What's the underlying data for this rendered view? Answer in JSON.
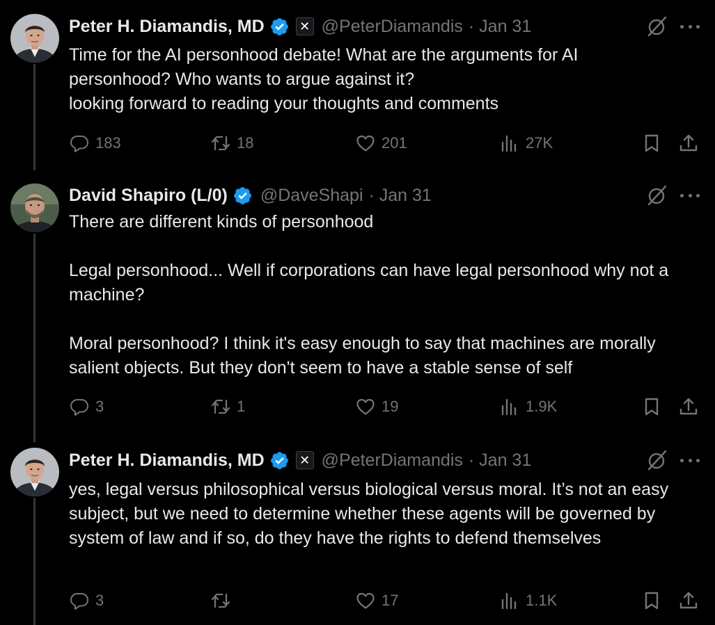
{
  "colors": {
    "background": "#000000",
    "text_primary": "#e7e9ea",
    "text_secondary": "#71767b",
    "verified_badge": "#1d9bf0",
    "thread_line": "#333639"
  },
  "icons": {
    "verified": "verified-badge-icon",
    "affiliate": "x-affiliate-badge-icon",
    "grok": "grok-icon",
    "more": "more-icon",
    "reply": "reply-icon",
    "retweet": "retweet-icon",
    "like": "heart-icon",
    "views": "views-icon",
    "bookmark": "bookmark-icon",
    "share": "share-icon"
  },
  "tweets": [
    {
      "author": "Peter H. Diamandis, MD",
      "affiliate_badge": "✕",
      "handle": "@PeterDiamandis",
      "date": "· Jan 31",
      "paragraphs": [
        "Time for the AI personhood debate!  What are the arguments for AI personhood? Who wants to argue against it?",
        "looking forward to reading your thoughts and comments"
      ],
      "replies": "183",
      "retweets": "18",
      "likes": "201",
      "views": "27K"
    },
    {
      "author": "David Shapiro (L/0)",
      "handle": "@DaveShapi",
      "date": "· Jan 31",
      "paragraphs": [
        "There are different kinds of personhood",
        "Legal personhood... Well if corporations can have legal personhood why not a machine?",
        "Moral personhood? I think it's easy enough to say that machines are morally salient objects. But they don't seem to have a stable sense of self"
      ],
      "replies": "3",
      "retweets": "1",
      "likes": "19",
      "views": "1.9K"
    },
    {
      "author": "Peter H. Diamandis, MD",
      "affiliate_badge": "✕",
      "handle": "@PeterDiamandis",
      "date": "· Jan 31",
      "paragraphs": [
        "yes, legal versus philosophical versus biological versus moral. It’s not an easy subject, but we need to determine whether these agents will be governed by system of law and if so, do they have the rights to defend themselves"
      ],
      "replies": "3",
      "retweets": "",
      "likes": "17",
      "views": "1.1K"
    }
  ]
}
